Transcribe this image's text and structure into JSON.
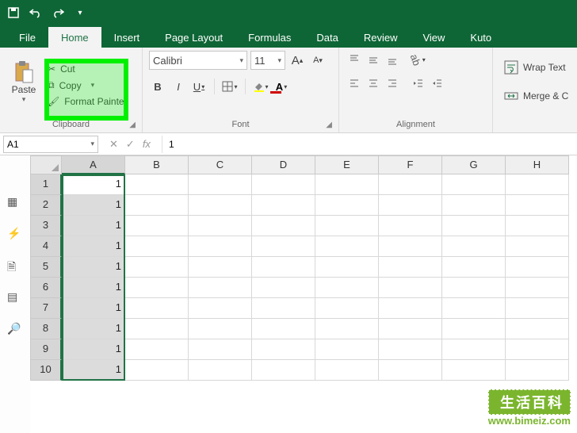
{
  "tabs": {
    "file": "File",
    "home": "Home",
    "insert": "Insert",
    "page_layout": "Page Layout",
    "formulas": "Formulas",
    "data": "Data",
    "review": "Review",
    "view": "View",
    "kutools": "Kuto"
  },
  "ribbon": {
    "clipboard": {
      "label": "Clipboard",
      "paste": "Paste",
      "cut": "Cut",
      "copy": "Copy",
      "format_painter": "Format Painter"
    },
    "font": {
      "label": "Font",
      "name": "Calibri",
      "size": "11",
      "bold": "B",
      "italic": "I",
      "underline": "U",
      "grow": "A",
      "shrink": "A"
    },
    "alignment": {
      "label": "Alignment",
      "wrap": "Wrap Text",
      "merge": "Merge & C"
    }
  },
  "namebox": "A1",
  "fx": "fx",
  "formula_value": "1",
  "columns": [
    "A",
    "B",
    "C",
    "D",
    "E",
    "F",
    "G",
    "H"
  ],
  "rows": [
    {
      "n": "1",
      "v": "1"
    },
    {
      "n": "2",
      "v": "1"
    },
    {
      "n": "3",
      "v": "1"
    },
    {
      "n": "4",
      "v": "1"
    },
    {
      "n": "5",
      "v": "1"
    },
    {
      "n": "6",
      "v": "1"
    },
    {
      "n": "7",
      "v": "1"
    },
    {
      "n": "8",
      "v": "1"
    },
    {
      "n": "9",
      "v": "1"
    },
    {
      "n": "10",
      "v": "1"
    }
  ],
  "watermark": {
    "top": "生活百科",
    "url": "www.bimeiz.com"
  }
}
